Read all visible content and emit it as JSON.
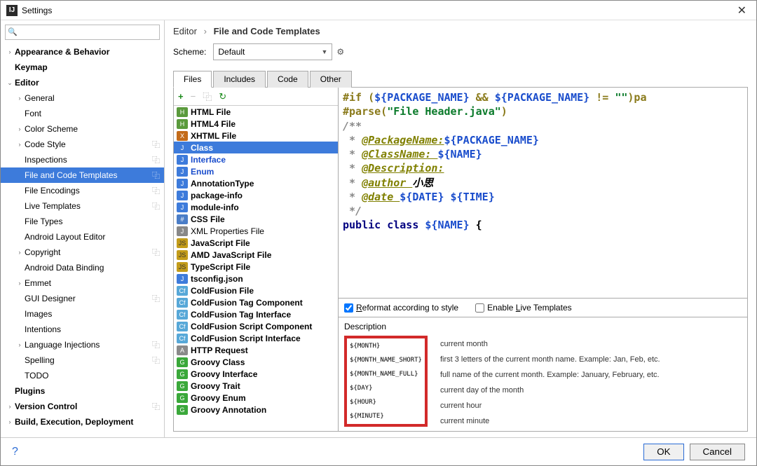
{
  "window": {
    "title": "Settings",
    "close": "✕"
  },
  "search": {
    "placeholder": ""
  },
  "sidebar": {
    "items": [
      {
        "label": "Appearance & Behavior",
        "arrow": "›",
        "indent": 0,
        "bold": true
      },
      {
        "label": "Keymap",
        "arrow": "",
        "indent": 0,
        "bold": true
      },
      {
        "label": "Editor",
        "arrow": "⌄",
        "indent": 0,
        "bold": true
      },
      {
        "label": "General",
        "arrow": "›",
        "indent": 1
      },
      {
        "label": "Font",
        "arrow": "",
        "indent": 1
      },
      {
        "label": "Color Scheme",
        "arrow": "›",
        "indent": 1
      },
      {
        "label": "Code Style",
        "arrow": "›",
        "indent": 1,
        "copy": true
      },
      {
        "label": "Inspections",
        "arrow": "",
        "indent": 1,
        "copy": true
      },
      {
        "label": "File and Code Templates",
        "arrow": "",
        "indent": 1,
        "copy": true,
        "selected": true
      },
      {
        "label": "File Encodings",
        "arrow": "",
        "indent": 1,
        "copy": true
      },
      {
        "label": "Live Templates",
        "arrow": "",
        "indent": 1,
        "copy": true
      },
      {
        "label": "File Types",
        "arrow": "",
        "indent": 1
      },
      {
        "label": "Android Layout Editor",
        "arrow": "",
        "indent": 1
      },
      {
        "label": "Copyright",
        "arrow": "›",
        "indent": 1,
        "copy": true
      },
      {
        "label": "Android Data Binding",
        "arrow": "",
        "indent": 1
      },
      {
        "label": "Emmet",
        "arrow": "›",
        "indent": 1
      },
      {
        "label": "GUI Designer",
        "arrow": "",
        "indent": 1,
        "copy": true
      },
      {
        "label": "Images",
        "arrow": "",
        "indent": 1
      },
      {
        "label": "Intentions",
        "arrow": "",
        "indent": 1
      },
      {
        "label": "Language Injections",
        "arrow": "›",
        "indent": 1,
        "copy": true
      },
      {
        "label": "Spelling",
        "arrow": "",
        "indent": 1,
        "copy": true
      },
      {
        "label": "TODO",
        "arrow": "",
        "indent": 1
      },
      {
        "label": "Plugins",
        "arrow": "",
        "indent": 0,
        "bold": true
      },
      {
        "label": "Version Control",
        "arrow": "›",
        "indent": 0,
        "bold": true,
        "copy": true
      },
      {
        "label": "Build, Execution, Deployment",
        "arrow": "›",
        "indent": 0,
        "bold": true
      }
    ]
  },
  "breadcrumb": {
    "p1": "Editor",
    "p2": "File and Code Templates"
  },
  "scheme": {
    "label": "Scheme:",
    "value": "Default"
  },
  "tabs": [
    "Files",
    "Includes",
    "Code",
    "Other"
  ],
  "toolbar": {
    "add": "+",
    "remove": "−",
    "copy": "⿻",
    "reset": "↻"
  },
  "templates": [
    {
      "name": "HTML File",
      "ico": "ico-html",
      "bold": true
    },
    {
      "name": "HTML4 File",
      "ico": "ico-html",
      "bold": true
    },
    {
      "name": "XHTML File",
      "ico": "ico-x",
      "bold": true
    },
    {
      "name": "Class",
      "ico": "ico-j",
      "bold": true,
      "blue": true,
      "selected": true
    },
    {
      "name": "Interface",
      "ico": "ico-j",
      "bold": true,
      "blue": true
    },
    {
      "name": "Enum",
      "ico": "ico-j",
      "bold": true,
      "blue": true
    },
    {
      "name": "AnnotationType",
      "ico": "ico-j",
      "bold": true
    },
    {
      "name": "package-info",
      "ico": "ico-j",
      "bold": true
    },
    {
      "name": "module-info",
      "ico": "ico-j",
      "bold": true
    },
    {
      "name": "CSS File",
      "ico": "ico-css",
      "bold": true
    },
    {
      "name": "XML Properties File",
      "ico": "ico-txt"
    },
    {
      "name": "JavaScript File",
      "ico": "ico-js",
      "bold": true
    },
    {
      "name": "AMD JavaScript File",
      "ico": "ico-js",
      "bold": true
    },
    {
      "name": "TypeScript File",
      "ico": "ico-js",
      "bold": true
    },
    {
      "name": "tsconfig.json",
      "ico": "ico-j",
      "bold": true
    },
    {
      "name": "ColdFusion File",
      "ico": "ico-cf",
      "bold": true
    },
    {
      "name": "ColdFusion Tag Component",
      "ico": "ico-cf",
      "bold": true
    },
    {
      "name": "ColdFusion Tag Interface",
      "ico": "ico-cf",
      "bold": true
    },
    {
      "name": "ColdFusion Script Component",
      "ico": "ico-cf",
      "bold": true
    },
    {
      "name": "ColdFusion Script Interface",
      "ico": "ico-cf",
      "bold": true
    },
    {
      "name": "HTTP Request",
      "ico": "ico-api",
      "bold": true
    },
    {
      "name": "Groovy Class",
      "ico": "ico-g",
      "bold": true
    },
    {
      "name": "Groovy Interface",
      "ico": "ico-g",
      "bold": true
    },
    {
      "name": "Groovy Trait",
      "ico": "ico-g",
      "bold": true
    },
    {
      "name": "Groovy Enum",
      "ico": "ico-g",
      "bold": true
    },
    {
      "name": "Groovy Annotation",
      "ico": "ico-g",
      "bold": true
    }
  ],
  "code": {
    "l1a": "#if (",
    "l1b": "${PACKAGE_NAME}",
    "l1c": " && ",
    "l1d": "${PACKAGE_NAME}",
    "l1e": " != ",
    "l1f": "\"\"",
    "l1g": ")pa",
    "l2a": "#parse(",
    "l2b": "\"File Header.java\"",
    "l2c": ")",
    "l3": "/**",
    "l4a": " * ",
    "l4b": "@PackageName:",
    "l4c": "${PACKAGE_NAME}",
    "l5a": " * ",
    "l5b": "@ClassName: ",
    "l5c": "${NAME}",
    "l6a": " * ",
    "l6b": "@Description:",
    "l7a": " * ",
    "l7b": "@author ",
    "l7c": "小思",
    "l8a": " * ",
    "l8b": "@date ",
    "l8c": "${DATE}",
    "l8d": " ",
    "l8e": "${TIME}",
    "l9": " */",
    "l10a": "public",
    "l10b": " ",
    "l10c": "class",
    "l10d": " ",
    "l10e": "${NAME}",
    "l10f": " {"
  },
  "options": {
    "reformat": "Reformat according to style",
    "reformat_ul": "R",
    "live": "Enable Live Templates",
    "live_ul": "L"
  },
  "desc": {
    "title": "Description",
    "vars": [
      "${MONTH}",
      "${MONTH_NAME_SHORT}",
      "${MONTH_NAME_FULL}",
      "${DAY}",
      "${HOUR}",
      "${MINUTE}"
    ],
    "texts": [
      "current month",
      "first 3 letters of the current month name. Example: Jan, Feb, etc.",
      "full name of the current month. Example: January, February, etc.",
      "current day of the month",
      "current hour",
      "current minute"
    ]
  },
  "footer": {
    "ok": "OK",
    "cancel": "Cancel",
    "help": "?"
  },
  "watermark": ""
}
